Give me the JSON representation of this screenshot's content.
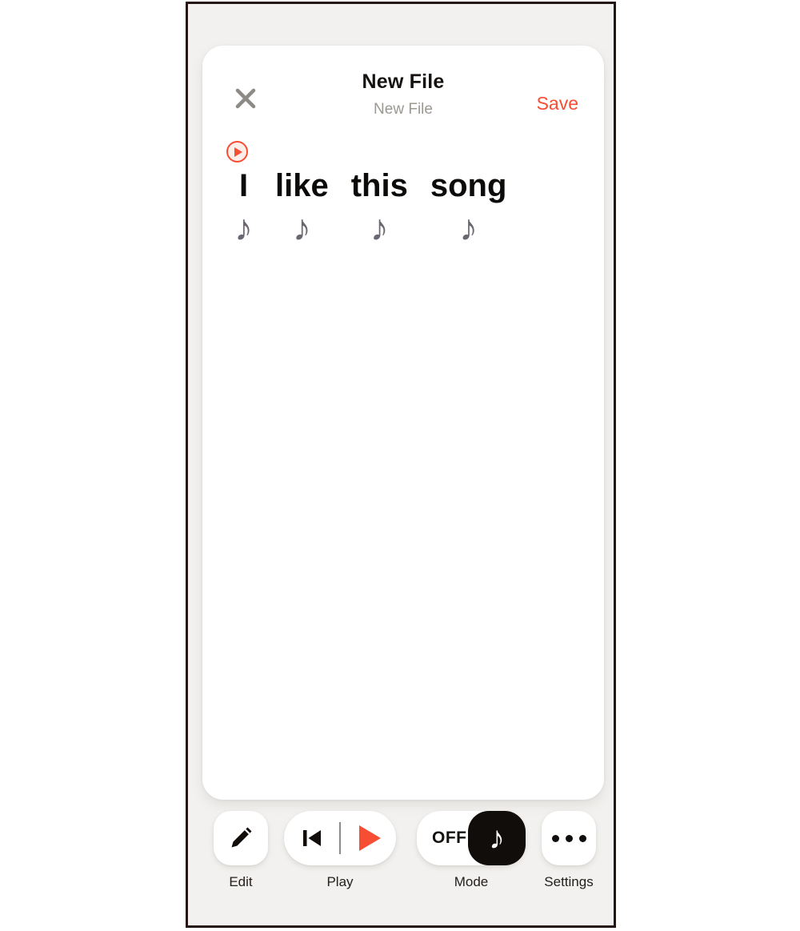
{
  "header": {
    "title": "New File",
    "subtitle": "New File",
    "save_label": "Save",
    "close_icon": "close-x-icon"
  },
  "editor": {
    "playhead_icon": "play-circle-icon",
    "tokens": [
      {
        "word": "I",
        "note": "♪"
      },
      {
        "word": "like",
        "note": "♪"
      },
      {
        "word": "this",
        "note": "♪"
      },
      {
        "word": "song",
        "note": "♪"
      }
    ]
  },
  "toolbar": {
    "edit": {
      "label": "Edit",
      "icon": "pencil-icon"
    },
    "play": {
      "label": "Play",
      "prev_icon": "skip-back-icon",
      "play_icon": "play-triangle-icon"
    },
    "mode": {
      "label": "Mode",
      "state_text": "OFF",
      "knob_icon": "music-note-icon",
      "knob_glyph": "♪"
    },
    "settings": {
      "label": "Settings",
      "icon": "ellipsis-icon"
    }
  },
  "colors": {
    "accent": "#f74d32",
    "background": "#f2f1ef",
    "card": "#ffffff",
    "text": "#15120f",
    "muted_text": "#9b9892",
    "note": "#6b6670",
    "knob": "#100d0b"
  }
}
